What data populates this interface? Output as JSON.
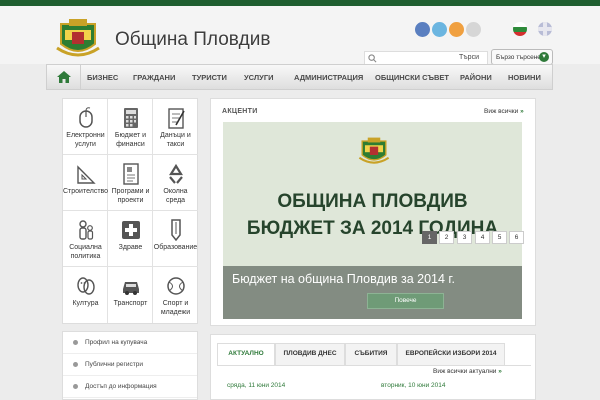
{
  "header": {
    "site_title": "Община Пловдив",
    "search_label": "Търси",
    "quick_search_label": "Бързо търсене"
  },
  "nav": {
    "items": [
      "БИЗНЕС",
      "ГРАЖДАНИ",
      "ТУРИСТИ",
      "УСЛУГИ",
      "АДМИНИСТРАЦИЯ",
      "ОБЩИНСКИ СЪВЕТ",
      "РАЙОНИ",
      "НОВИНИ"
    ]
  },
  "sidebar": {
    "tiles": [
      {
        "label": "Електронни услуги",
        "icon": "mouse-icon"
      },
      {
        "label": "Бюджет и финанси",
        "icon": "calculator-icon"
      },
      {
        "label": "Данъци и такси",
        "icon": "notepad-icon"
      },
      {
        "label": "Строителство",
        "icon": "ruler-icon"
      },
      {
        "label": "Програми и проекти",
        "icon": "document-icon"
      },
      {
        "label": "Околна среда",
        "icon": "recycle-icon"
      },
      {
        "label": "Социална политика",
        "icon": "people-icon"
      },
      {
        "label": "Здраве",
        "icon": "medical-cross-icon"
      },
      {
        "label": "Образование",
        "icon": "pencil-icon"
      },
      {
        "label": "Култура",
        "icon": "theater-masks-icon"
      },
      {
        "label": "Транспорт",
        "icon": "car-icon"
      },
      {
        "label": "Спорт и младежи",
        "icon": "ball-icon"
      }
    ],
    "links": [
      "Профил на купувача",
      "Публични регистри",
      "Достъп до информация"
    ]
  },
  "highlights": {
    "title": "АКЦЕНТИ",
    "see_all": "Виж всички",
    "banner_line1": "ОБЩИНА ПЛОВДИВ",
    "banner_line2": "БЮДЖЕТ ЗА 2014 ГОДИНА",
    "caption": "Бюджет на община Пловдив за 2014 г.",
    "caption_button": "Повече",
    "pages": [
      "1",
      "2",
      "3",
      "4",
      "5",
      "6"
    ],
    "active_page": "1"
  },
  "news": {
    "tabs": [
      "АКТУАЛНО",
      "ПЛОВДИВ ДНЕС",
      "СЪБИТИЯ",
      "ЕВРОПЕЙСКИ ИЗБОРИ 2014"
    ],
    "see_all": "Виж всички актуални",
    "dates": [
      "сряда, 11 юни 2014",
      "вторник, 10 юни 2014"
    ]
  },
  "colors": {
    "brand_green": "#2f7a3a",
    "top_bar": "#1f5e2f"
  }
}
